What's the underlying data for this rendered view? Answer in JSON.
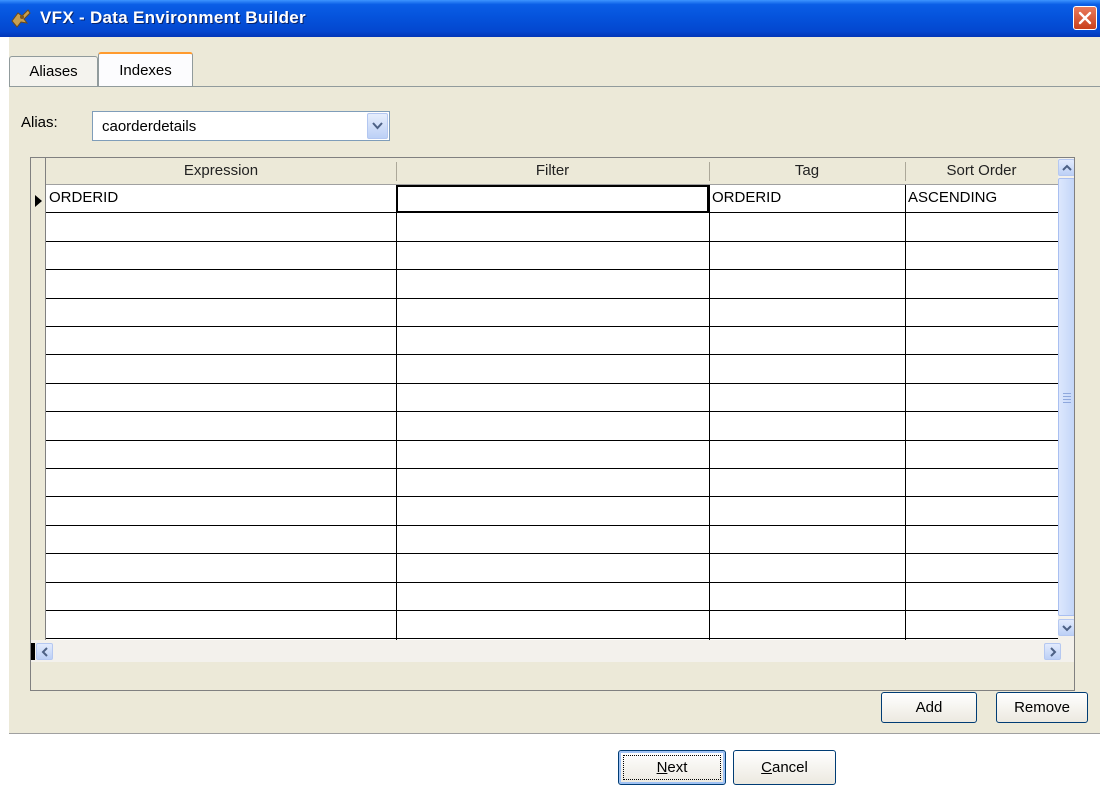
{
  "window": {
    "title": "VFX - Data Environment Builder",
    "icon": "vfx-app-icon",
    "close_icon": "close-icon"
  },
  "tabs": [
    {
      "label": "Aliases",
      "active": false
    },
    {
      "label": "Indexes",
      "active": true
    }
  ],
  "alias": {
    "label": "Alias:",
    "selected": "caorderdetails"
  },
  "grid": {
    "columns": [
      "Expression",
      "Filter",
      "Tag",
      "Sort Order"
    ],
    "rows": [
      {
        "expression": "ORDERID",
        "filter": "",
        "tag": "ORDERID",
        "sort_order": "ASCENDING"
      }
    ],
    "empty_rows": 15
  },
  "buttons": {
    "add": "Add",
    "remove": "Remove",
    "next_mnemonic": "N",
    "next_rest": "ext",
    "cancel_mnemonic": "C",
    "cancel_rest": "ancel"
  },
  "colors": {
    "titlebar": "#0553dc",
    "dialog_bg": "#ece9d8",
    "tab_accent": "#ff9a2e",
    "close_button": "#c9401c"
  }
}
